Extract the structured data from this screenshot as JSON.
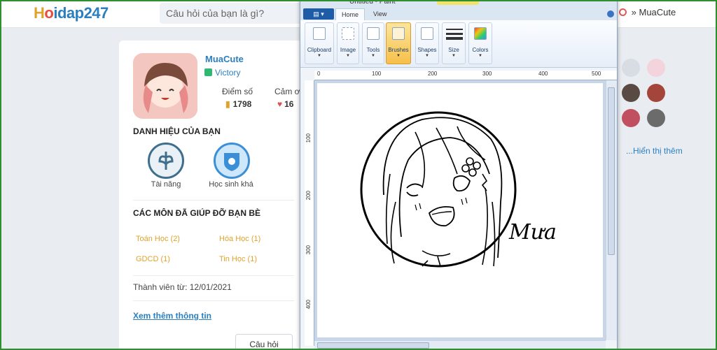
{
  "header": {
    "logo_prefix": "H",
    "logo_circle": "o",
    "logo_text": "idap247",
    "search_placeholder": "Câu hỏi của bạn là gì?",
    "username": "MuaCute",
    "user_chevron": "»"
  },
  "profile": {
    "name": "MuaCute",
    "rank": "Victory",
    "score_label": "Điểm số",
    "score_value": "1798",
    "thanks_label": "Cảm ơ",
    "thanks_value": "16",
    "titles_heading": "DANH HIỆU CỦA BẠN",
    "badges": [
      {
        "label": "Tài năng",
        "icon": "leaf-badge-icon"
      },
      {
        "label": "Học sinh khá",
        "icon": "shield-badge-icon"
      }
    ],
    "subjects_heading": "CÁC MÔN ĐÃ GIÚP ĐỠ BẠN BÈ",
    "subjects": [
      "Toán Học (2)",
      "Hóa Học (1)",
      "GDCD (1)",
      "Tin Học (1)"
    ],
    "member_since": "Thành viên từ: 12/01/2021",
    "more_info": "Xem thêm thông tin",
    "ask_button": "Câu hỏi"
  },
  "sidebar": {
    "show_more": "...Hiển thị thêm"
  },
  "paint": {
    "title": "Untitled - Paint",
    "file_menu": "▤ ▾",
    "tabs": [
      "Home",
      "View"
    ],
    "ribbon": [
      "Clipboard",
      "Image",
      "Tools",
      "Brushes",
      "Shapes",
      "Size",
      "Colors"
    ],
    "ruler_h": [
      "0",
      "100",
      "200",
      "300",
      "400",
      "500"
    ],
    "ruler_v": [
      "100",
      "200",
      "300",
      "400"
    ],
    "signature": "Mưa"
  },
  "colors": {
    "brand_blue": "#2c7fbf",
    "accent_gold": "#e0a22a",
    "frame_green": "#2f8f2f"
  }
}
